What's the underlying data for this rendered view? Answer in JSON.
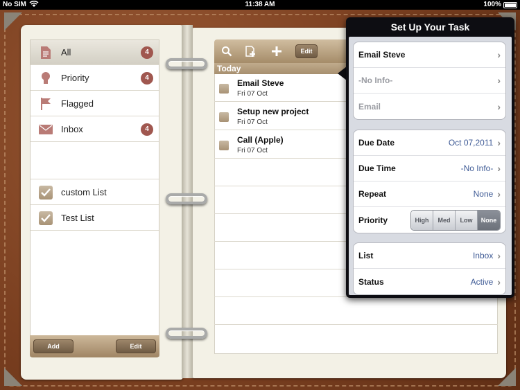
{
  "status_bar": {
    "carrier": "No SIM",
    "time": "11:38 AM",
    "battery": "100%"
  },
  "lists": {
    "items": [
      {
        "label": "All",
        "count": "4",
        "icon": "document-icon"
      },
      {
        "label": "Priority",
        "count": "4",
        "icon": "lightbulb-icon"
      },
      {
        "label": "Flagged",
        "count": "",
        "icon": "flag-icon"
      },
      {
        "label": "Inbox",
        "count": "4",
        "icon": "envelope-icon"
      }
    ],
    "custom": [
      {
        "label": "custom List"
      },
      {
        "label": "Test List"
      }
    ],
    "add_label": "Add",
    "edit_label": "Edit"
  },
  "tasks": {
    "edit_label": "Edit",
    "section": "Today",
    "items": [
      {
        "name": "Email Steve",
        "date": "Fri 07 Oct"
      },
      {
        "name": "Setup new project",
        "date": "Fri 07 Oct"
      },
      {
        "name": "Call (Apple)",
        "date": "Fri 07 Oct"
      }
    ]
  },
  "popover": {
    "title": "Set Up Your Task",
    "task_name": "Email Steve",
    "info_placeholder": "-No Info-",
    "email_placeholder": "Email",
    "due_date_label": "Due Date",
    "due_date_value": "Oct 07,2011",
    "due_time_label": "Due Time",
    "due_time_value": "-No Info-",
    "repeat_label": "Repeat",
    "repeat_value": "None",
    "priority_label": "Priority",
    "priority_options": [
      "High",
      "Med",
      "Low",
      "None"
    ],
    "priority_selected": "None",
    "list_label": "List",
    "list_value": "Inbox",
    "status_label": "Status",
    "status_value": "Active"
  },
  "colors": {
    "badge": "#a0574f",
    "accent_value": "#3e5a95",
    "toolbar": "#a58c69"
  }
}
